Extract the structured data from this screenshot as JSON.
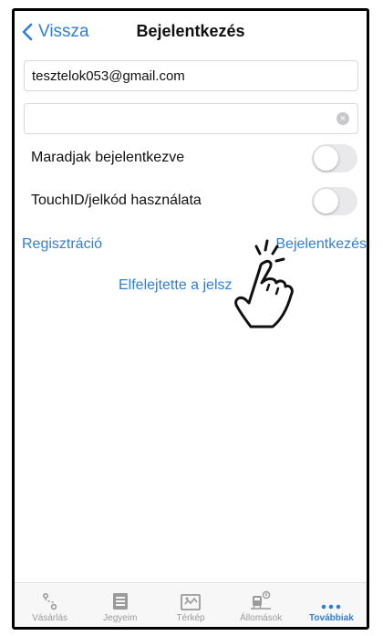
{
  "nav": {
    "back_label": "Vissza",
    "title": "Bejelentkezés"
  },
  "form": {
    "email_value": "tesztelok053@gmail.com",
    "password_value": "",
    "stay_logged_in_label": "Maradjak bejelentkezve",
    "stay_logged_in_on": false,
    "touchid_label": "TouchID/jelkód használata",
    "touchid_on": false
  },
  "links": {
    "register": "Regisztráció",
    "login": "Bejelentkezés",
    "forgot": "Elfelejtette a jelsz"
  },
  "tabs": [
    {
      "label": "Vásárlás",
      "icon": "route-icon",
      "active": false
    },
    {
      "label": "Jegyeim",
      "icon": "tickets-icon",
      "active": false
    },
    {
      "label": "Térkép",
      "icon": "map-icon",
      "active": false
    },
    {
      "label": "Állomások",
      "icon": "station-icon",
      "active": false
    },
    {
      "label": "Továbbiak",
      "icon": "more-icon",
      "active": true
    }
  ],
  "colors": {
    "accent": "#2f7fd6",
    "tab_inactive": "#9a9a9a",
    "toggle_off": "#e9e9eb"
  }
}
